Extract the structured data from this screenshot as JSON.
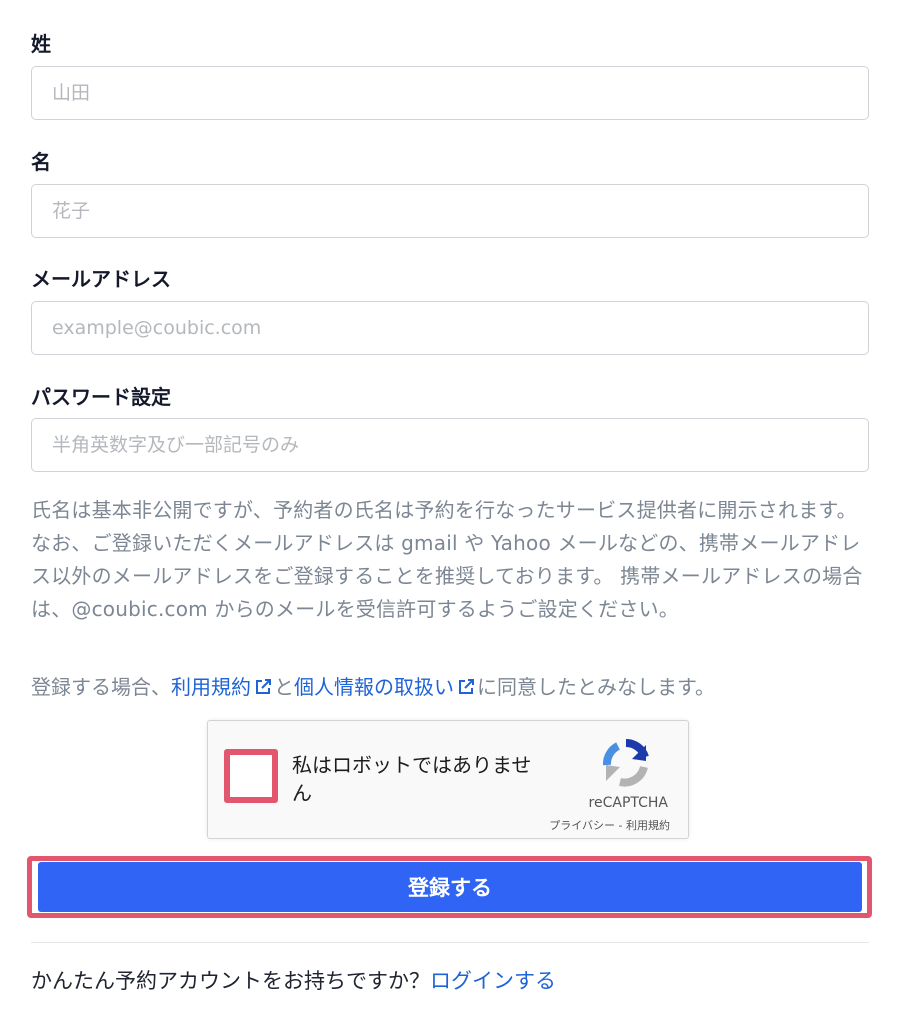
{
  "fields": {
    "last_name": {
      "label": "姓",
      "placeholder": "山田",
      "value": ""
    },
    "first_name": {
      "label": "名",
      "placeholder": "花子",
      "value": ""
    },
    "email": {
      "label": "メールアドレス",
      "placeholder": "example@coubic.com",
      "value": ""
    },
    "password": {
      "label": "パスワード設定",
      "placeholder": "半角英数字及び一部記号のみ",
      "value": ""
    }
  },
  "notice": "氏名は基本非公開ですが、予約者の氏名は予約を行なったサービス提供者に開示されます。 なお、ご登録いただくメールアドレスは gmail や Yahoo メールなどの、携帯メールアドレス以外のメールアドレスをご登録することを推奨しております。 携帯メールアドレスの場合は、@coubic.com からのメールを受信許可するようご設定ください。",
  "terms": {
    "prefix": "登録する場合、",
    "terms_link": "利用規約",
    "connector": "と",
    "privacy_link": "個人情報の取扱い",
    "suffix": "に同意したとみなします。"
  },
  "recaptcha": {
    "label": "私はロボットではありません",
    "brand": "reCAPTCHA",
    "privacy": "プライバシー",
    "separator": " - ",
    "terms": "利用規約"
  },
  "submit_label": "登録する",
  "login": {
    "prompt": "かんたん予約アカウントをお持ちですか？",
    "link": "ログインする"
  },
  "colors": {
    "primary_button": "#2f64f5",
    "link": "#1f64d6",
    "highlight": "#e2566e",
    "muted_text": "#7d8794"
  },
  "icons": {
    "external_link": "external-link-icon",
    "recaptcha_logo": "recaptcha-logo-icon"
  }
}
